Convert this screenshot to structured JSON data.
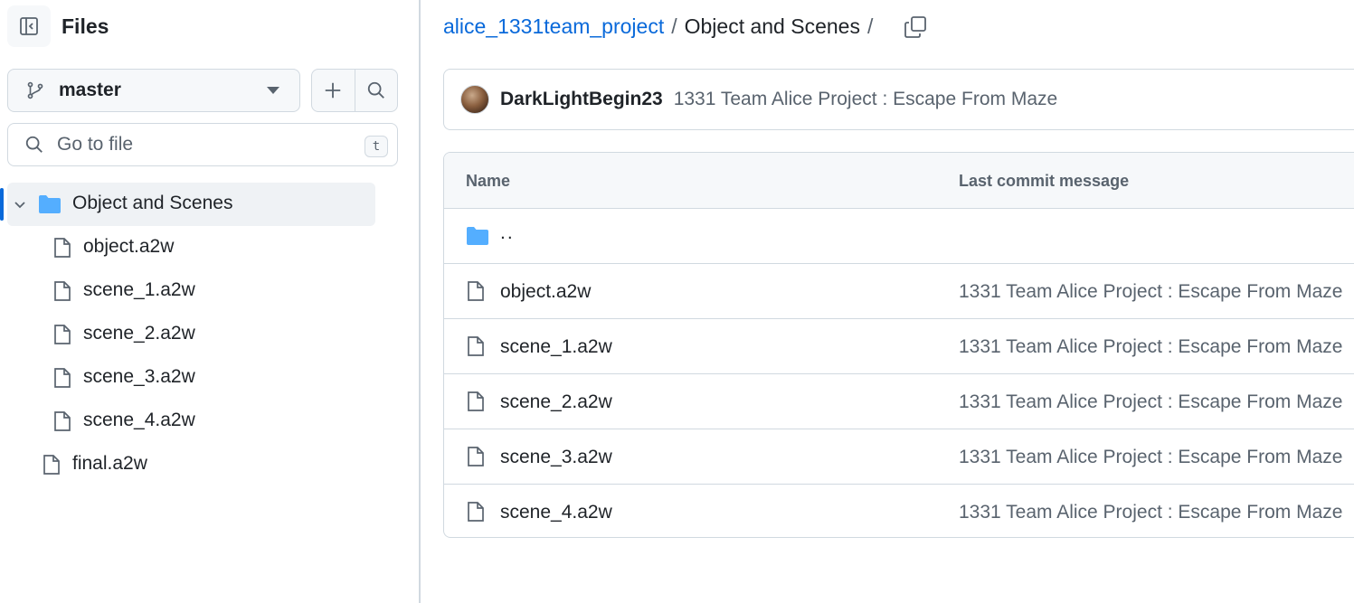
{
  "sidebar": {
    "title": "Files",
    "branch": {
      "name": "master"
    },
    "search": {
      "placeholder": "Go to file",
      "shortcut": "t"
    },
    "tree": {
      "folder": {
        "label": "Object and Scenes",
        "expanded": true,
        "active": true
      },
      "children": [
        {
          "label": "object.a2w"
        },
        {
          "label": "scene_1.a2w"
        },
        {
          "label": "scene_2.a2w"
        },
        {
          "label": "scene_3.a2w"
        },
        {
          "label": "scene_4.a2w"
        }
      ],
      "root_files": [
        {
          "label": "final.a2w"
        }
      ]
    }
  },
  "main": {
    "breadcrumb": {
      "repo": "alice_1331team_project",
      "separator": "/",
      "current": "Object and Scenes",
      "trailing_separator": "/"
    },
    "latest_commit": {
      "author": "DarkLightBegin23",
      "message": "1331 Team Alice Project : Escape From Maze"
    },
    "table": {
      "headers": {
        "name": "Name",
        "message": "Last commit message"
      },
      "parent_row": {
        "name": ".."
      },
      "rows": [
        {
          "name": "object.a2w",
          "message": "1331 Team Alice Project : Escape From Maze"
        },
        {
          "name": "scene_1.a2w",
          "message": "1331 Team Alice Project : Escape From Maze"
        },
        {
          "name": "scene_2.a2w",
          "message": "1331 Team Alice Project : Escape From Maze"
        },
        {
          "name": "scene_3.a2w",
          "message": "1331 Team Alice Project : Escape From Maze"
        },
        {
          "name": "scene_4.a2w",
          "message": "1331 Team Alice Project : Escape From Maze"
        }
      ]
    }
  },
  "icons": {
    "panel_toggle": "sidebar-collapse-icon",
    "branch": "git-branch-icon",
    "add": "plus-icon",
    "search": "search-icon",
    "chevron": "chevron-down-icon",
    "folder": "folder-icon",
    "file": "file-icon",
    "copy": "copy-icon"
  },
  "colors": {
    "accent": "#0969da",
    "folder": "#54aeff",
    "border": "#d1d9e0",
    "muted_text": "#59636e",
    "text": "#1f2328",
    "subtle_bg": "#f6f8fa",
    "active_bg": "#eff2f5"
  }
}
